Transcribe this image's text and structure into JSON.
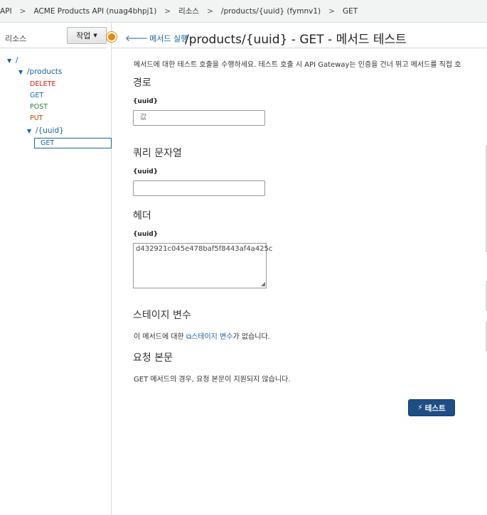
{
  "breadcrumb": {
    "items": [
      "API",
      "ACME Products API (nuag4bhpj1)",
      "리소스",
      "/products/{uuid} (fymnv1)",
      "GET"
    ],
    "separator": ">"
  },
  "sidebar": {
    "title": "리소스",
    "action_label": "작업",
    "tree": {
      "root": "/",
      "products": "/products",
      "methods": [
        "DELETE",
        "GET",
        "POST",
        "PUT"
      ],
      "uuid": "/{uuid}",
      "uuid_method": "GET"
    }
  },
  "header": {
    "back_label": "메서드 실행",
    "title": "/products/{uuid} - GET - 메서드 테스트"
  },
  "main": {
    "description": "메서드에 대한 테스트 호출을 수행하세요. 테스트 호출 시 API Gateway는 인증을 건너 뛰고 메서드를 직접 호",
    "path": {
      "heading": "경로",
      "label": "{uuid}",
      "placeholder": "값"
    },
    "query": {
      "heading": "쿼리 문자열",
      "label": "{uuid}",
      "value": ""
    },
    "headers": {
      "heading": "헤더",
      "label": "{uuid}",
      "value": "d432921c045e478baf5f8443af4a425c"
    },
    "stage": {
      "heading": "스테이지 변수",
      "prefix": "이 메서드에 대한 ",
      "link": "스테이지 변수",
      "suffix": "가 없습니다."
    },
    "body": {
      "heading": "요청 본문",
      "note": "GET 메서드의 경우, 요청 본문이 지원되지 않습니다."
    },
    "test_label": "테스트"
  },
  "colors": {
    "accent": "#1a64a8",
    "primary_button": "#1e4e84",
    "delete": "#d0211b",
    "post": "#2e7d32",
    "put": "#c04a00",
    "toggle": "#e8870d"
  }
}
